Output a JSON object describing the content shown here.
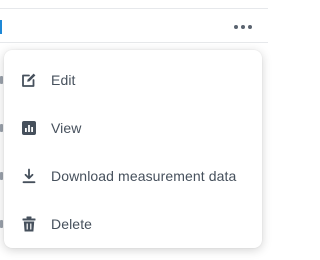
{
  "colors": {
    "accent": "#1e88d6",
    "icon": "#46505c",
    "text": "#46505c",
    "divider": "#e6e8eb"
  },
  "header": {
    "more_icon": "more-horizontal-icon"
  },
  "menu": {
    "items": [
      {
        "label": "Edit",
        "icon": "edit-icon"
      },
      {
        "label": "View",
        "icon": "bar-chart-icon"
      },
      {
        "label": "Download measurement data",
        "icon": "download-icon"
      },
      {
        "label": "Delete",
        "icon": "trash-icon"
      }
    ]
  }
}
